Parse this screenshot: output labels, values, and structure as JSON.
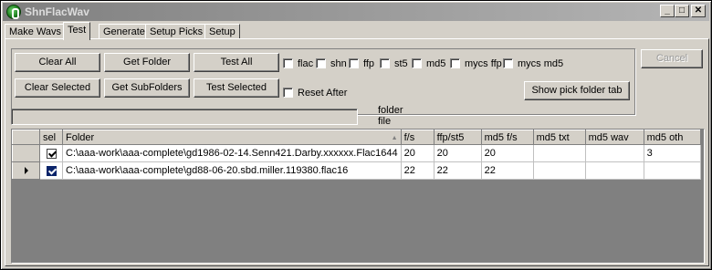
{
  "window": {
    "title": "ShnFlacWav",
    "minimize_glyph": "_",
    "maximize_glyph": "□",
    "close_glyph": "✕"
  },
  "tabs": [
    {
      "label": "Make Wavs"
    },
    {
      "label": "Test"
    },
    {
      "label": "Generate"
    },
    {
      "label": "Setup Picks"
    },
    {
      "label": "Setup"
    }
  ],
  "buttons": {
    "clear_all": "Clear All",
    "get_folder": "Get Folder",
    "test_all": "Test All",
    "clear_selected": "Clear Selected",
    "get_subfolders": "Get SubFolders",
    "test_selected": "Test Selected",
    "cancel": "Cancel",
    "show_pick_folder_tab": "Show pick folder tab"
  },
  "checkboxes": [
    {
      "label": "flac",
      "checked": false
    },
    {
      "label": "shn",
      "checked": false
    },
    {
      "label": "ffp",
      "checked": false
    },
    {
      "label": "st5",
      "checked": false
    },
    {
      "label": "md5",
      "checked": false
    },
    {
      "label": "mycs ffp",
      "checked": false
    },
    {
      "label": "mycs md5",
      "checked": false
    }
  ],
  "reset_after": {
    "label": "Reset After",
    "checked": false
  },
  "status": {
    "box_value": "",
    "folder_label": "folder",
    "file_label": "file"
  },
  "grid": {
    "columns": [
      "sel",
      "Folder",
      "f/s",
      "ffp/st5",
      "md5 f/s",
      "md5 txt",
      "md5 wav",
      "md5 oth"
    ],
    "sort_glyph": "▲",
    "rows": [
      {
        "current": false,
        "sel": true,
        "cells": [
          "C:\\aaa-work\\aaa-complete\\gd1986-02-14.Senn421.Darby.xxxxxx.Flac1644",
          "20",
          "20",
          "20",
          "",
          "",
          "3"
        ]
      },
      {
        "current": true,
        "sel": true,
        "cells": [
          "C:\\aaa-work\\aaa-complete\\gd88-06-20.sbd.miller.119380.flac16",
          "22",
          "22",
          "22",
          "",
          "",
          ""
        ]
      }
    ]
  },
  "colors": {
    "face": "#d4d0c8",
    "title_gradient": [
      "#7f7f7f",
      "#b5b5b5"
    ],
    "grid_background": "#808080",
    "selection": "#0a246a"
  }
}
